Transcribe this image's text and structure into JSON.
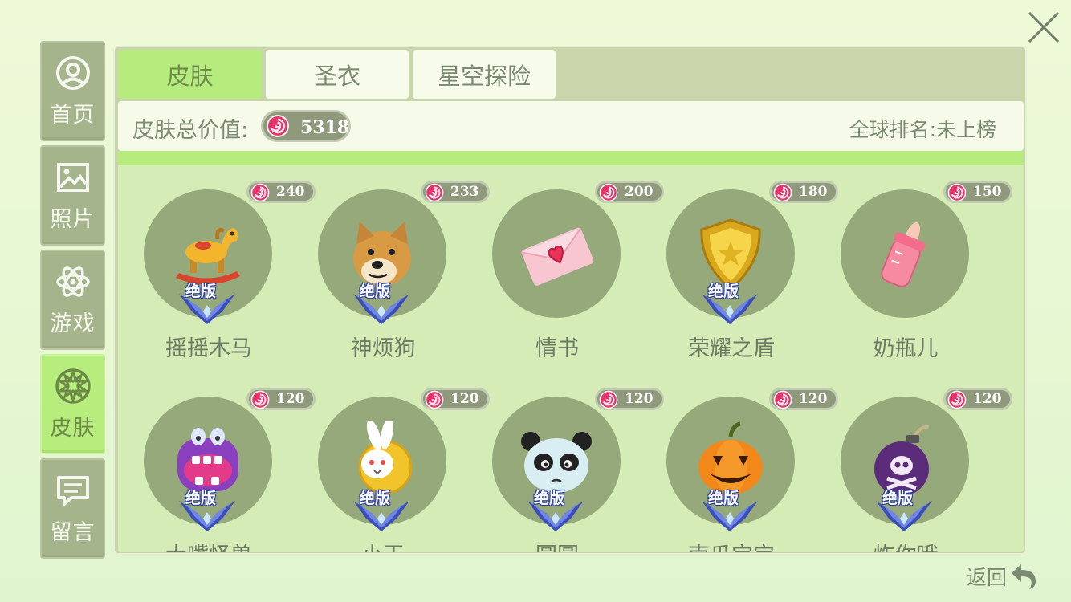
{
  "sidebar": {
    "items": [
      {
        "label": "首页",
        "icon": "user-circle-icon",
        "active": false
      },
      {
        "label": "照片",
        "icon": "picture-icon",
        "active": false
      },
      {
        "label": "游戏",
        "icon": "atom-icon",
        "active": false
      },
      {
        "label": "皮肤",
        "icon": "flower-badge-icon",
        "active": true
      },
      {
        "label": "留言",
        "icon": "chat-bubble-icon",
        "active": false
      }
    ]
  },
  "tabs": [
    {
      "label": "皮肤",
      "active": true
    },
    {
      "label": "圣衣",
      "active": false
    },
    {
      "label": "星空探险",
      "active": false
    }
  ],
  "summary": {
    "total_label": "皮肤总价值:",
    "total_value": "5318",
    "rank_text": "全球排名:未上榜"
  },
  "skins": [
    {
      "name": "摇摇木马",
      "price": "240",
      "badge": "绝版",
      "icon": "rocking-horse-icon"
    },
    {
      "name": "神烦狗",
      "price": "233",
      "badge": "绝版",
      "icon": "doge-icon"
    },
    {
      "name": "情书",
      "price": "200",
      "badge": "",
      "icon": "love-letter-icon"
    },
    {
      "name": "荣耀之盾",
      "price": "180",
      "badge": "绝版",
      "icon": "golden-shield-icon"
    },
    {
      "name": "奶瓶儿",
      "price": "150",
      "badge": "",
      "icon": "baby-bottle-icon"
    },
    {
      "name": "大嘴怪兽",
      "price": "120",
      "badge": "绝版",
      "icon": "monster-icon"
    },
    {
      "name": "小王",
      "price": "120",
      "badge": "绝版",
      "icon": "rabbit-icon"
    },
    {
      "name": "圆圆",
      "price": "120",
      "badge": "绝版",
      "icon": "panda-icon"
    },
    {
      "name": "南瓜宝宝",
      "price": "120",
      "badge": "绝版",
      "icon": "pumpkin-icon"
    },
    {
      "name": "炸你哦",
      "price": "120",
      "badge": "绝版",
      "icon": "skull-bomb-icon"
    }
  ],
  "back_label": "返回",
  "colors": {
    "accent_green": "#b6ec7d",
    "panel": "#c9d6ab",
    "circle": "#96a97b",
    "candy": "#e8336a"
  }
}
